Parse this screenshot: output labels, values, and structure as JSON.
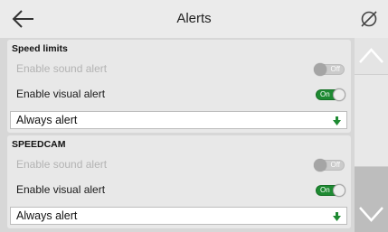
{
  "header": {
    "title": "Alerts",
    "back_icon": "arrow-left-icon",
    "right_icon": "no-entry-icon"
  },
  "sections": [
    {
      "title": "Speed limits",
      "sound": {
        "label": "Enable sound alert",
        "state": "Off",
        "enabled": false
      },
      "visual": {
        "label": "Enable visual alert",
        "state": "On",
        "enabled": true
      },
      "dropdown": {
        "value": "Always alert"
      }
    },
    {
      "title": "SPEEDCAM",
      "sound": {
        "label": "Enable sound alert",
        "state": "Off",
        "enabled": false
      },
      "visual": {
        "label": "Enable visual alert",
        "state": "On",
        "enabled": true
      },
      "dropdown": {
        "value": "Always alert"
      }
    }
  ],
  "scrollbar": {
    "up_icon": "chevron-up-icon",
    "down_icon": "chevron-down-icon"
  },
  "colors": {
    "toggle_on": "#1e8a32",
    "dropdown_arrow": "#1e8a32",
    "disabled_text": "#b3b3b3"
  }
}
